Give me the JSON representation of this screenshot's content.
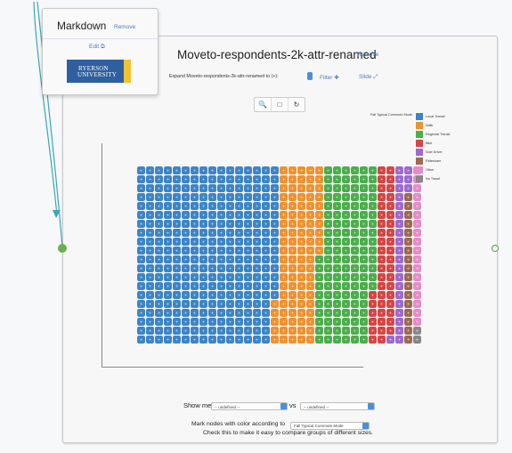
{
  "markdown_card": {
    "title": "Markdown",
    "remove_label": "Remove",
    "edit_label": "Edit ⧉",
    "logo_line1": "RYERSON",
    "logo_line2": "UNIVERSITY"
  },
  "viz_card": {
    "title": "Moveto-respondents-2k-attr-renamed",
    "remove_label": "Remove",
    "expand_label": "Expand Moveto-respondents-2k-attr-renamed to (+):",
    "filter_label": "Filter ✚",
    "slide_label": "Slide ⤢",
    "toolbar": {
      "zoom_icon": "🔍",
      "fit_icon": "□",
      "undo_icon": "↻"
    }
  },
  "controls": {
    "show_me_label": "Show me",
    "vs_label": "vs",
    "select_a": "-- undefined --",
    "select_b": "-- undefined --",
    "mark_label": "Mark nodes with color according to",
    "mark_value": "Fall Typical Commute Mode",
    "check_label": "Check this to make it easy to compare groups of different sizes."
  },
  "chart_data": {
    "type": "waffle",
    "legend_title": "Fall Typical Commute Mode",
    "categories": [
      "Local Transit",
      "Walk",
      "Regional Transit",
      "Bike",
      "Sole Driver",
      "Rideshare",
      "Other",
      "No Travel"
    ],
    "colors": [
      "#3d85c6",
      "#f0922e",
      "#4cae4c",
      "#d64545",
      "#9c6ad0",
      "#9a6a55",
      "#e58cc8",
      "#888888"
    ],
    "rows": 20,
    "counts": [
      315,
      95,
      124,
      45,
      24,
      17,
      18,
      2
    ]
  }
}
